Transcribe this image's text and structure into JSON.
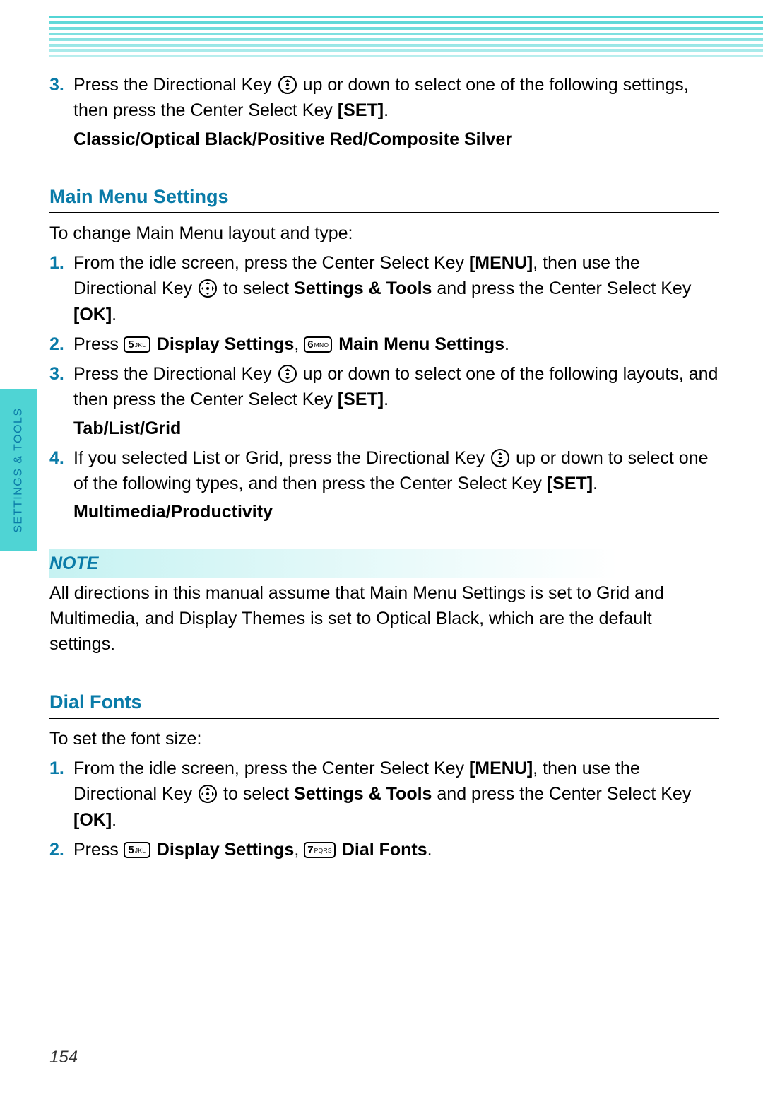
{
  "sideTab": "SETTINGS & TOOLS",
  "pageNumber": "154",
  "section0": {
    "step3_a": "Press the Directional Key ",
    "step3_b": " up or down to select one of the following settings, then press the Center Select Key ",
    "step3_set": "[SET]",
    "step3_end": ".",
    "options": "Classic/Optical Black/Positive Red/Composite Silver"
  },
  "section1": {
    "heading": "Main Menu Settings",
    "intro": "To change Main Menu layout and type:",
    "step1_a": "From the idle screen, press the Center Select Key ",
    "step1_menu": "[MENU]",
    "step1_b": ", then use the Directional Key ",
    "step1_c": " to select ",
    "step1_st": "Settings & Tools",
    "step1_d": " and press the Center Select Key ",
    "step1_ok": "[OK]",
    "step1_end": ".",
    "step2_press": "Press ",
    "step2_key5": {
      "digit": "5",
      "letters": "JKL"
    },
    "step2_ds": "Display Settings",
    "step2_sep": ", ",
    "step2_key6": {
      "digit": "6",
      "letters": "MNO"
    },
    "step2_mms": "Main Menu Settings",
    "step2_end": ".",
    "step3_a": "Press the Directional Key ",
    "step3_b": " up or down to select one of the following layouts, and then press the Center Select Key ",
    "step3_set": "[SET]",
    "step3_end": ".",
    "step3_opts": "Tab/List/Grid",
    "step4_a": "If you selected List or Grid, press the Directional Key ",
    "step4_b": " up or down to select one of the following types, and then press the Center Select Key ",
    "step4_set": "[SET]",
    "step4_end": ".",
    "step4_opts": "Multimedia/Productivity"
  },
  "note": {
    "label": "NOTE",
    "text": "All directions in this manual assume that Main Menu Settings is set to Grid and Multimedia, and Display Themes is set to Optical Black, which are the default settings."
  },
  "section2": {
    "heading": "Dial Fonts",
    "intro": "To set the font size:",
    "step1_a": "From the idle screen, press the Center Select Key ",
    "step1_menu": "[MENU]",
    "step1_b": ", then use the Directional Key ",
    "step1_c": " to select ",
    "step1_st": "Settings & Tools",
    "step1_d": " and press the Center Select Key ",
    "step1_ok": "[OK]",
    "step1_end": ".",
    "step2_press": "Press ",
    "step2_key5": {
      "digit": "5",
      "letters": "JKL"
    },
    "step2_ds": "Display Settings",
    "step2_sep": ", ",
    "step2_key7": {
      "digit": "7",
      "letters": "PQRS"
    },
    "step2_df": "Dial Fonts",
    "step2_end": "."
  }
}
